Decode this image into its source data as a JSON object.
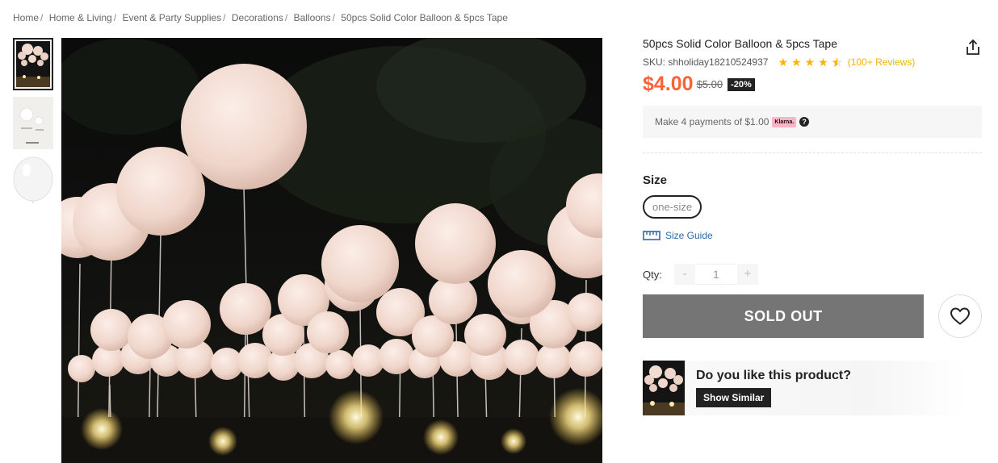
{
  "breadcrumb": {
    "items": [
      "Home",
      "Home & Living",
      "Event & Party Supplies",
      "Decorations",
      "Balloons",
      "50pcs Solid Color Balloon & 5pcs Tape"
    ],
    "separator": "/"
  },
  "product": {
    "title": "50pcs Solid Color Balloon & 5pcs Tape",
    "sku": "SKU: shholiday18210524937",
    "rating": 4.5,
    "reviews": "(100+ Reviews)",
    "price": "$4.00",
    "original_price": "$5.00",
    "discount": "-20%",
    "installments": "Make 4 payments of $1.00",
    "klarna_label": "Klarna."
  },
  "size": {
    "label": "Size",
    "options": [
      "one-size"
    ],
    "guide_label": "Size Guide"
  },
  "quantity": {
    "label": "Qty:",
    "value": "1",
    "minus": "-",
    "plus": "+"
  },
  "actions": {
    "sold_out_label": "SOLD OUT"
  },
  "like": {
    "question": "Do you like this product?",
    "button_label": "Show Similar"
  },
  "colors": {
    "price": "#fa6338",
    "rating": "#f7b500",
    "sold_out_bg": "#757575",
    "link": "#2d68a8"
  },
  "icons": {
    "share": "share-icon",
    "heart": "heart-icon",
    "ruler": "ruler-icon",
    "help": "help-icon",
    "star": "star-icon"
  }
}
